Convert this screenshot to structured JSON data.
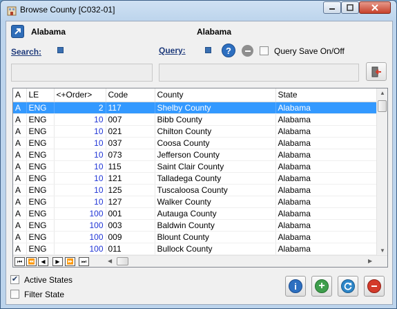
{
  "window": {
    "title": "Browse County [C032-01]"
  },
  "header": {
    "left_label": "Alabama",
    "center_label": "Alabama"
  },
  "search": {
    "label": "Search:",
    "value": ""
  },
  "query": {
    "label": "Query:",
    "value": "",
    "save_label": "Query Save On/Off",
    "save_checked": false
  },
  "grid": {
    "columns": [
      "A",
      "LE",
      "<+Order>",
      "Code",
      "County",
      "State"
    ],
    "rows": [
      [
        "A",
        "ENG",
        "2",
        "117",
        "Shelby County",
        "Alabama"
      ],
      [
        "A",
        "ENG",
        "10",
        "007",
        "Bibb County",
        "Alabama"
      ],
      [
        "A",
        "ENG",
        "10",
        "021",
        "Chilton County",
        "Alabama"
      ],
      [
        "A",
        "ENG",
        "10",
        "037",
        "Coosa County",
        "Alabama"
      ],
      [
        "A",
        "ENG",
        "10",
        "073",
        "Jefferson County",
        "Alabama"
      ],
      [
        "A",
        "ENG",
        "10",
        "115",
        "Saint Clair County",
        "Alabama"
      ],
      [
        "A",
        "ENG",
        "10",
        "121",
        "Talladega County",
        "Alabama"
      ],
      [
        "A",
        "ENG",
        "10",
        "125",
        "Tuscaloosa County",
        "Alabama"
      ],
      [
        "A",
        "ENG",
        "10",
        "127",
        "Walker County",
        "Alabama"
      ],
      [
        "A",
        "ENG",
        "100",
        "001",
        "Autauga County",
        "Alabama"
      ],
      [
        "A",
        "ENG",
        "100",
        "003",
        "Baldwin County",
        "Alabama"
      ],
      [
        "A",
        "ENG",
        "100",
        "009",
        "Blount County",
        "Alabama"
      ],
      [
        "A",
        "ENG",
        "100",
        "011",
        "Bullock County",
        "Alabama"
      ]
    ],
    "selected_row": 0
  },
  "options": {
    "active_states_label": "Active States",
    "active_states_checked": true,
    "filter_state_label": "Filter State",
    "filter_state_checked": false
  },
  "icons": {
    "app": "building-icon",
    "go": "arrow-up-right-icon",
    "help": "question-icon",
    "clear": "minus-icon",
    "exit": "exit-door-icon",
    "info": "info-icon",
    "add": "plus-icon",
    "refresh": "refresh-icon",
    "delete": "minus-icon"
  },
  "colors": {
    "selection": "#3399ff",
    "order_number": "#1f34d6",
    "label_navy": "#1e3a7b",
    "add_green": "#3e9e4c",
    "delete_red": "#d33a2a",
    "info_blue": "#2d6fc0"
  }
}
